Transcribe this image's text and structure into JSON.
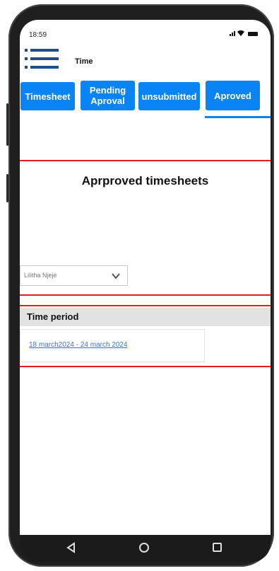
{
  "status_bar": {
    "time": "18:59",
    "icons": [
      "signal-icon",
      "wifi-icon",
      "battery-icon"
    ]
  },
  "header": {
    "menu_icon": "hamburger-menu-icon",
    "title": "Time"
  },
  "tabs": [
    {
      "label": "Timesheet",
      "active": false
    },
    {
      "label": "Pending Aproval",
      "active": false
    },
    {
      "label": "unsubmitted",
      "active": false
    },
    {
      "label": "Aproved",
      "active": true
    }
  ],
  "main": {
    "heading": "Aprproved timesheets",
    "employee_select": {
      "value": "Lilitha Njeje",
      "icon": "chevron-down-icon"
    },
    "table": {
      "column_header": "Time period",
      "rows": [
        "18 march2024 - 24 march 2024"
      ]
    }
  },
  "nav_bar": {
    "icons": [
      "back-icon",
      "home-icon",
      "recent-apps-icon"
    ]
  },
  "colors": {
    "accent": "#0a84f2",
    "menu_icon": "#1f4c8a",
    "highlight_box": "#e02020",
    "link": "#3b73d9",
    "table_header_bg": "#e2e2e2"
  }
}
